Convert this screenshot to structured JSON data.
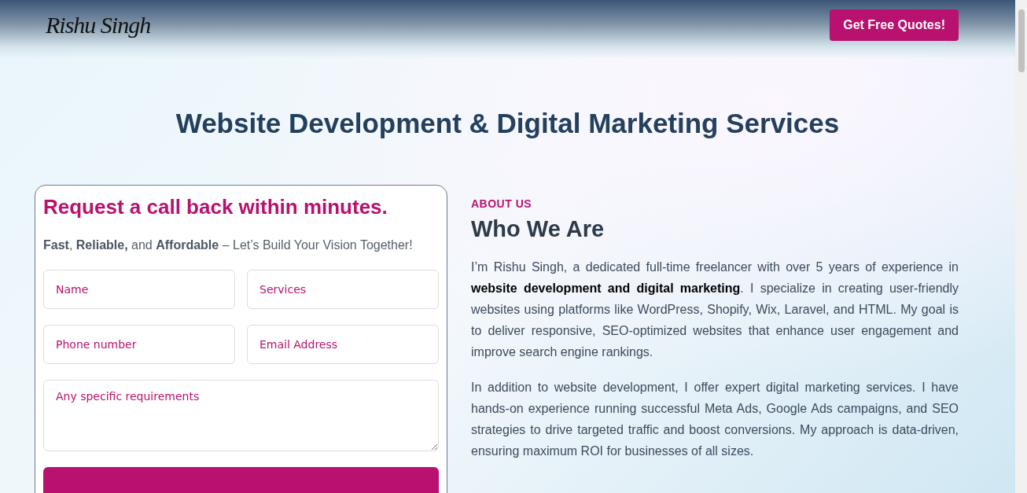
{
  "header": {
    "logo": "Rishu Singh",
    "cta": "Get Free Quotes!"
  },
  "hero": {
    "title": "Website Development & Digital Marketing Services"
  },
  "callback_form": {
    "title": "Request a call back within minutes.",
    "subtitle": "**Fast**, **Reliable,** and **Affordable** – Let’s Build Your Vision Together!",
    "fields": [
      {
        "kind": "input",
        "placeholder": "Name"
      },
      {
        "kind": "input",
        "placeholder": "Services"
      },
      {
        "kind": "input",
        "placeholder": "Phone number"
      },
      {
        "kind": "input",
        "placeholder": "Email Address"
      },
      {
        "kind": "textarea",
        "placeholder": "Any specific requirements"
      }
    ]
  },
  "about": {
    "eyebrow": "ABOUT US",
    "title": "Who We Are",
    "paragraphs": [
      "I’m Rishu Singh, a dedicated full-time freelancer with over 5 years of experience in **website development and digital marketing**. I specialize in creating user-friendly websites using platforms like WordPress, Shopify, Wix, Laravel, and HTML. My goal is to deliver responsive, SEO-optimized websites that enhance user engagement and improve search engine rankings.",
      "In addition to website development, I offer expert digital marketing services. I have hands-on experience running successful Meta Ads, Google Ads campaigns, and SEO strategies to drive targeted traffic and boost conversions. My approach is data-driven, ensuring maximum ROI for businesses of all sizes."
    ]
  }
}
